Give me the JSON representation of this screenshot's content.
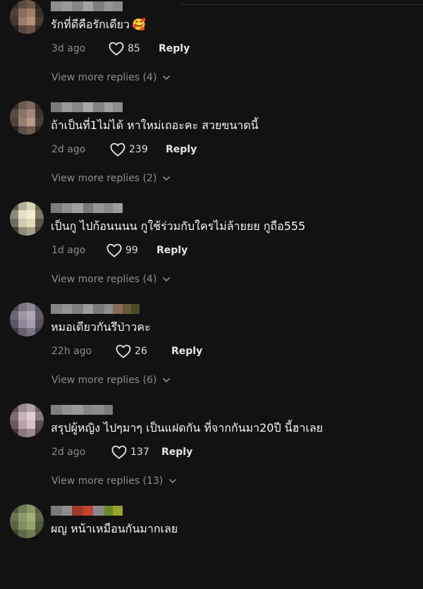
{
  "like_label": "Reply",
  "comments": [
    {
      "text": "รักที่ดีคือรักเดียว",
      "emoji": "🥰",
      "time": "3d ago",
      "likes": "85",
      "reply": "Reply",
      "view_more": "View more replies (4)",
      "avatar_colors": [
        "#3a2d28",
        "#5d4a42",
        "#6b564a",
        "#2e2623",
        "#4f3f37",
        "#8a6c5c",
        "#a07f6a",
        "#3c302b",
        "#453832",
        "#9b7b68",
        "#b58f78",
        "#4a3b33",
        "#2a2220",
        "#5a483f",
        "#6c5548",
        "#322824"
      ],
      "username_colors": [
        "#8e8e8e",
        "#9a9a9a",
        "#868686",
        "#a2a2a2",
        "#7e7e7e",
        "#959595",
        "#8a8a8a"
      ]
    },
    {
      "text": "ถ้าเป็นที่1ไม่ได้ หาใหม่เถอะคะ สวยขนาดนี้",
      "emoji": "",
      "time": "2d ago",
      "likes": "239",
      "reply": "Reply",
      "view_more": "View more replies (2)",
      "avatar_colors": [
        "#3b302c",
        "#6e5a52",
        "#7e675c",
        "#352b27",
        "#5a4a43",
        "#8e7466",
        "#a3877a",
        "#3d322d",
        "#4e413a",
        "#98806f",
        "#b69a88",
        "#4b3e37",
        "#2b2421",
        "#5d4d45",
        "#6f5c50",
        "#332a26"
      ],
      "username_colors": [
        "#7a7a7a",
        "#9a9a9a",
        "#888888",
        "#a8a8a8",
        "#838383",
        "#9f9f9f",
        "#8c8c8c"
      ]
    },
    {
      "text": "เป็นกู ไปก้อนนนน กูใช้ร่วมกับใครไม่ล้ายยย กูถือ555",
      "emoji": "",
      "time": "1d ago",
      "likes": "99",
      "reply": "Reply",
      "view_more": "View more replies (4)",
      "avatar_colors": [
        "#5a5a4e",
        "#b3b09a",
        "#d8d4bc",
        "#6a6758",
        "#8e8b78",
        "#e6e1c6",
        "#f1ecd0",
        "#7c7866",
        "#6f6c5d",
        "#cfc9ae",
        "#e0d9bb",
        "#59574b",
        "#3e3c34",
        "#8f8b77",
        "#a39f88",
        "#47453c"
      ],
      "username_colors": [
        "#7c7c7c",
        "#8f8f8f",
        "#a0a0a0",
        "#7a7a7a",
        "#959595",
        "#888888",
        "#9c9c9c"
      ]
    },
    {
      "text": "หมอเดียวกันรึป่าวคะ",
      "emoji": "",
      "time": "22h ago",
      "likes": "26",
      "reply": "Reply",
      "view_more": "View more replies (6)",
      "avatar_colors": [
        "#4e4a52",
        "#7a7582",
        "#8d8796",
        "#5a5560",
        "#6d6775",
        "#9f96a6",
        "#b2a8b8",
        "#625c68",
        "#5c5762",
        "#8f8797",
        "#a59bad",
        "#57525d",
        "#3e3b42",
        "#69636f",
        "#7b7482",
        "#48444d"
      ],
      "username_colors": [
        "#858585",
        "#939393",
        "#7f7f7f",
        "#9b9b9b",
        "#7a7a7a",
        "#8e8e8e",
        "#8a6a5a",
        "#6a5a3a",
        "#4a4a2a"
      ]
    },
    {
      "text": "สรุปผู้หญิง ไปๆมาๆ เป็นแฝดกัน ที่จากกันมา20ปี นี้ฮาเลย",
      "emoji": "",
      "time": "2d ago",
      "likes": "137",
      "reply": "Reply",
      "view_more": "View more replies (13)",
      "avatar_colors": [
        "#5c4e55",
        "#9a8a92",
        "#b59fa8",
        "#6e5e66",
        "#7e6c74",
        "#c8b2bc",
        "#e0ccd4",
        "#8c7a82",
        "#6a5860",
        "#b8a2ac",
        "#d6c0ca",
        "#5e4e55",
        "#45393f",
        "#8a7680",
        "#9e8892",
        "#4d4046"
      ],
      "username_colors": [
        "#7f7f7f",
        "#929292",
        "#9a9a9a",
        "#868686",
        "#8c8c8c",
        "#7a7a7a"
      ]
    },
    {
      "text": "ผญ หน้าเหมือนกันมากเลย",
      "emoji": "",
      "time": "",
      "likes": "",
      "reply": "",
      "view_more": "",
      "avatar_colors": [
        "#4e5a3e",
        "#6e7a56",
        "#8a9466",
        "#56603f",
        "#6a7450",
        "#8e9a6a",
        "#a4ae7c",
        "#5e6846",
        "#5a6444",
        "#848e62",
        "#98a270",
        "#4f5a3c",
        "#3c4630",
        "#606a48",
        "#707a54",
        "#454e36"
      ],
      "username_colors": [
        "#7a7a7a",
        "#8e8e8e",
        "#9e3a2a",
        "#c2442e",
        "#8a8a8a",
        "#6a8a2a",
        "#9aa22a"
      ]
    }
  ],
  "colors": {
    "background": "#121212",
    "text": "#f4f4f4",
    "muted": "#8a8a8a"
  }
}
